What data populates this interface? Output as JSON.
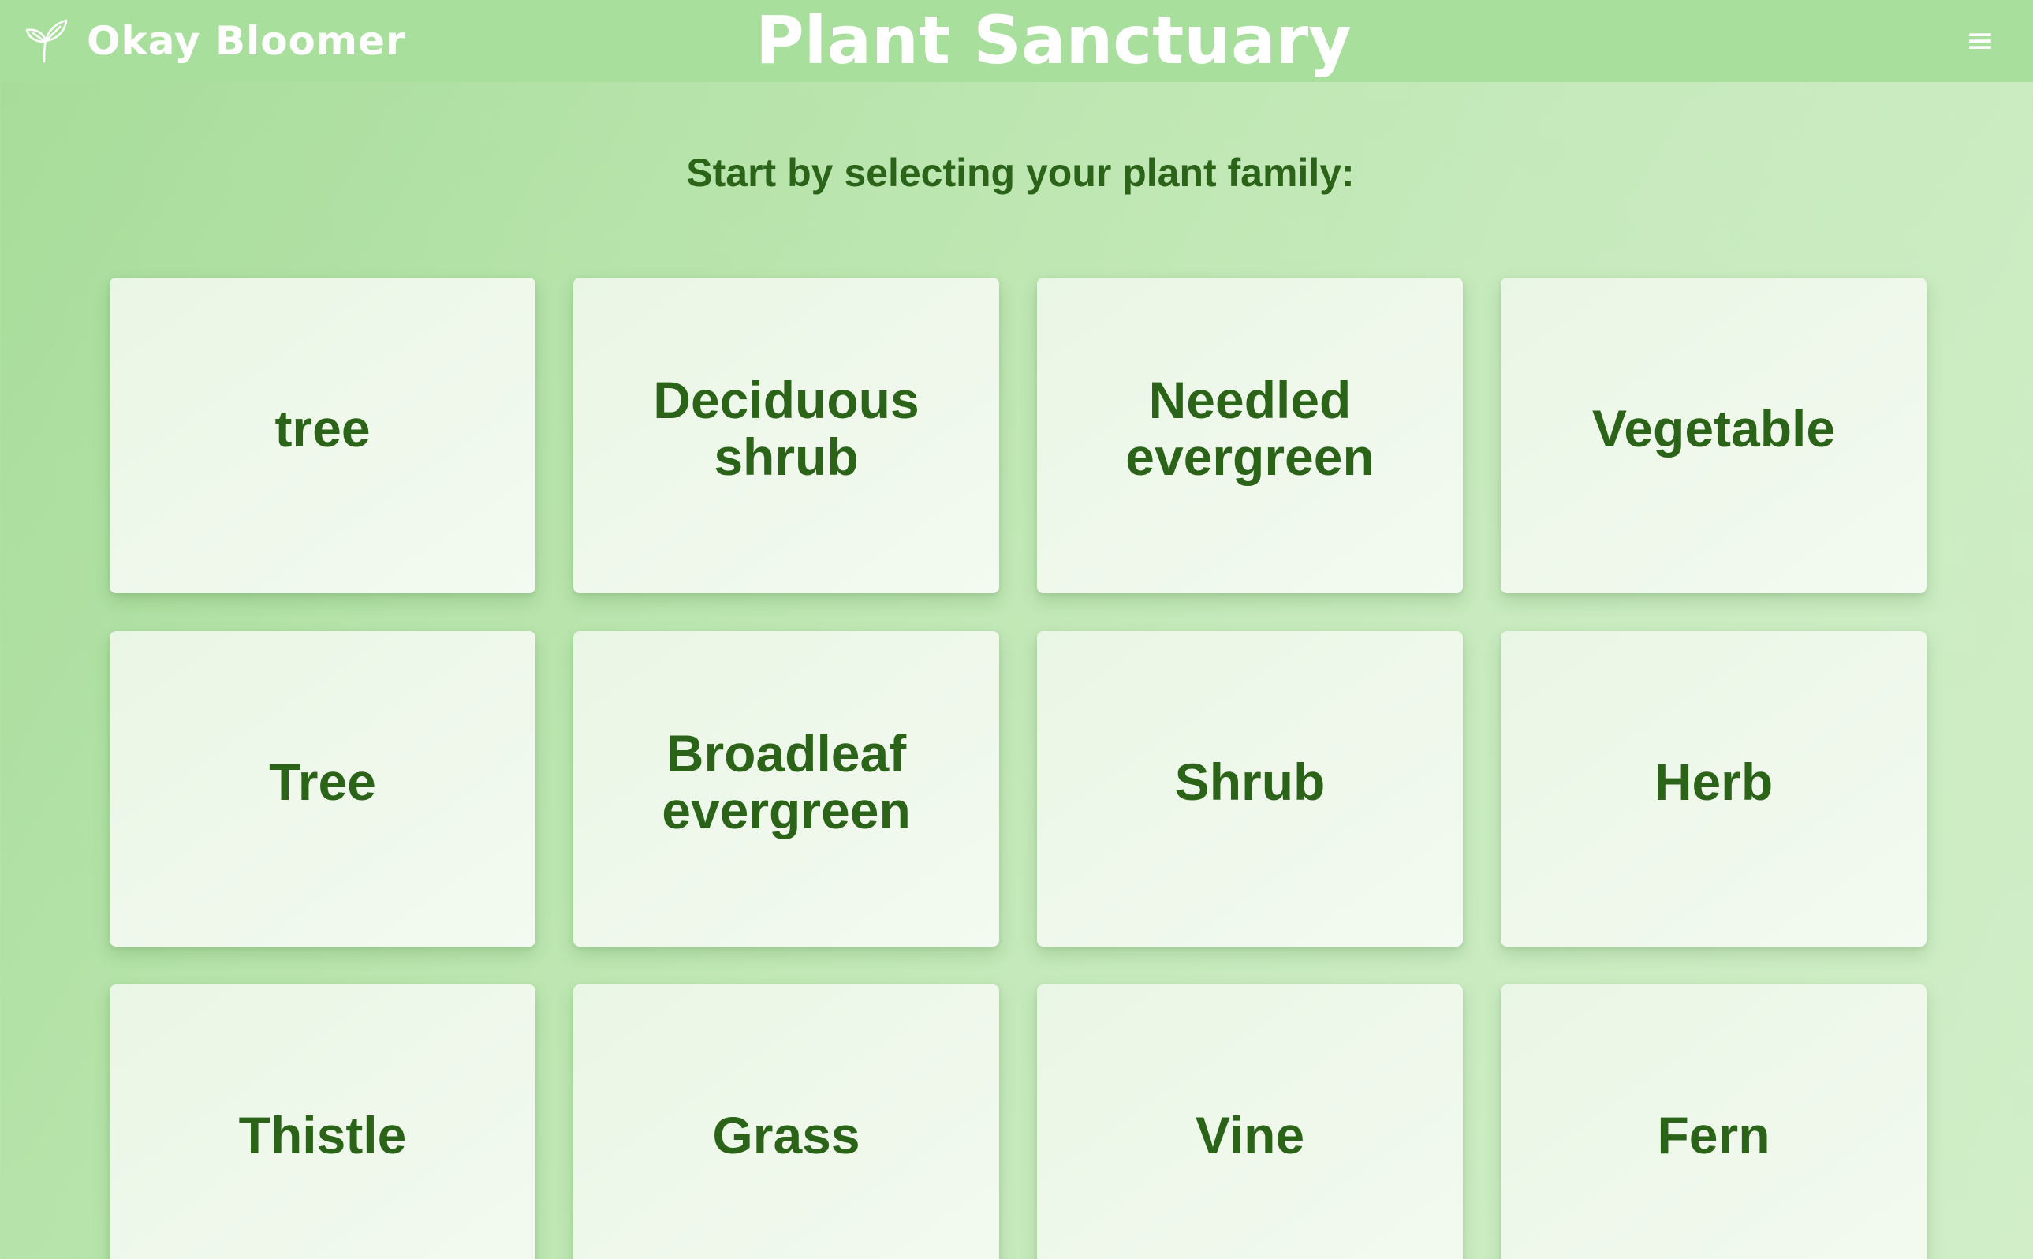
{
  "header": {
    "brand_icon": "leaf-sprout-icon",
    "brand_name": "Okay Bloomer",
    "title": "Plant Sanctuary",
    "menu_icon": "hamburger-menu-icon",
    "menu_glyph": "≡"
  },
  "main": {
    "prompt": "Start by selecting your plant family:",
    "families": [
      {
        "label": "tree"
      },
      {
        "label": "Deciduous shrub"
      },
      {
        "label": "Needled evergreen"
      },
      {
        "label": "Vegetable"
      },
      {
        "label": "Tree"
      },
      {
        "label": "Broadleaf evergreen"
      },
      {
        "label": "Shrub"
      },
      {
        "label": "Herb"
      },
      {
        "label": "Thistle"
      },
      {
        "label": "Grass"
      },
      {
        "label": "Vine"
      },
      {
        "label": "Fern"
      }
    ]
  },
  "colors": {
    "header_background": "#a8df9c",
    "page_gradient_start": "#a6dc99",
    "page_gradient_end": "#d1eec8",
    "card_background": "#eef8ea",
    "text_green": "#2b6418",
    "header_text": "#ffffff"
  }
}
